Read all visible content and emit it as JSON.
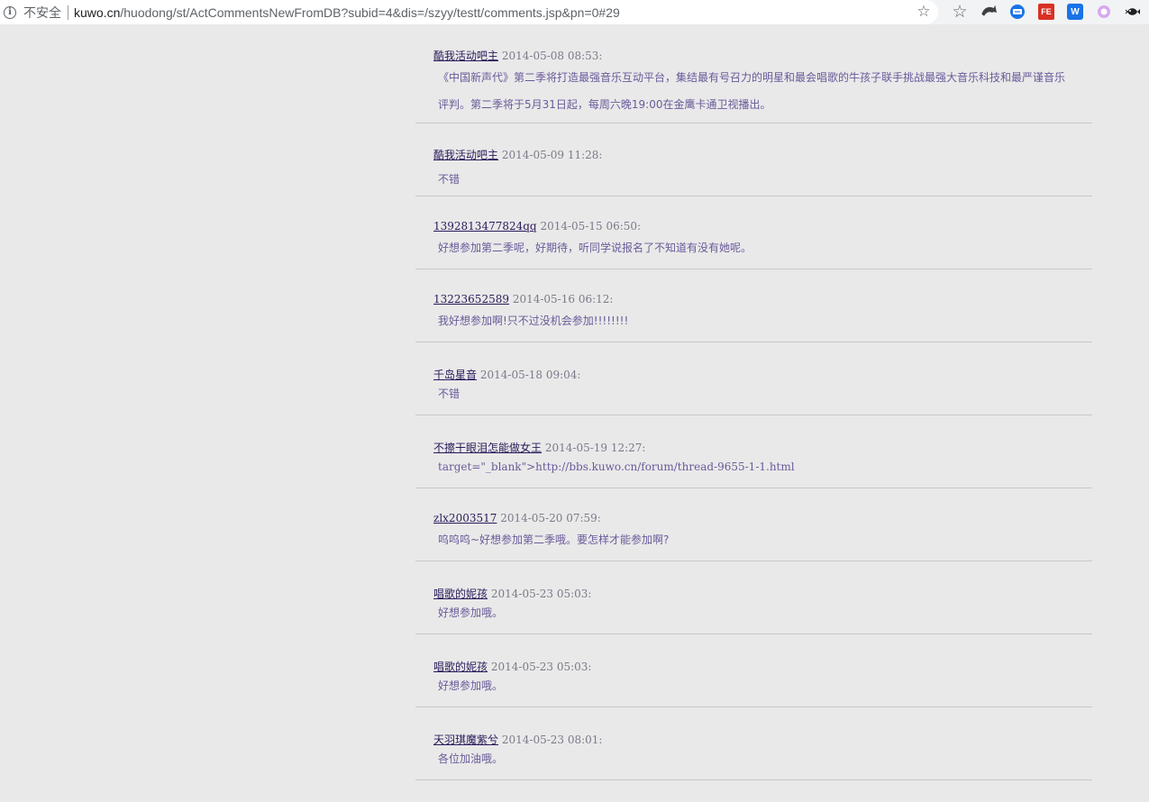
{
  "browser": {
    "security_label": "不安全",
    "url_host": "kuwo.cn",
    "url_rest": "/huodong/st/ActCommentsNewFromDB?subid=4&dis=/szyy/testt/comments.jsp&pn=0#29",
    "info_icon": "info-icon",
    "bookmark_icon": "star-icon",
    "extensions": [
      "star-icon",
      "arrow-icon",
      "chat-icon",
      "fe-icon",
      "w-icon",
      "ring-icon",
      "fish-icon"
    ],
    "ext_fe_label": "FE",
    "ext_w_label": "W"
  },
  "comments": [
    {
      "user": "酷我活动吧主",
      "time": "2014-05-08 08:53:",
      "text": "《中国新声代》第二季将打造最强音乐互动平台，集结最有号召力的明星和最会唱歌的牛孩子联手挑战最强大音乐科技和最严谨音乐",
      "text2": "评判。第二季将于5月31日起，每周六晚19:00在金鹰卡通卫视播出。"
    },
    {
      "user": "酷我活动吧主",
      "time": "2014-05-09 11:28:",
      "text": "不错"
    },
    {
      "user": "1392813477824qq",
      "time": "2014-05-15 06:50:",
      "text": "好想参加第二季呢，好期待，听同学说报名了不知道有没有她呢。"
    },
    {
      "user": "13223652589",
      "time": "2014-05-16 06:12:",
      "text": "我好想参加啊!只不过没机会参加!!!!!!!!"
    },
    {
      "user": "千岛星音",
      "time": "2014-05-18 09:04:",
      "text": "不错"
    },
    {
      "user": "不擦干眼泪怎能做女王",
      "time": "2014-05-19 12:27:",
      "text": "target=\"_blank\">http://bbs.kuwo.cn/forum/thread-9655-1-1.html"
    },
    {
      "user": "zlx2003517",
      "time": "2014-05-20 07:59:",
      "text": "呜呜呜~好想参加第二季哦。要怎样才能参加啊?"
    },
    {
      "user": "唱歌的妮孩",
      "time": "2014-05-23 05:03:",
      "text": "好想参加哦。"
    },
    {
      "user": "唱歌的妮孩",
      "time": "2014-05-23 05:03:",
      "text": "好想参加哦。"
    },
    {
      "user": "天羽琪魔紫兮",
      "time": "2014-05-23 08:01:",
      "text": "各位加油哦。"
    }
  ]
}
